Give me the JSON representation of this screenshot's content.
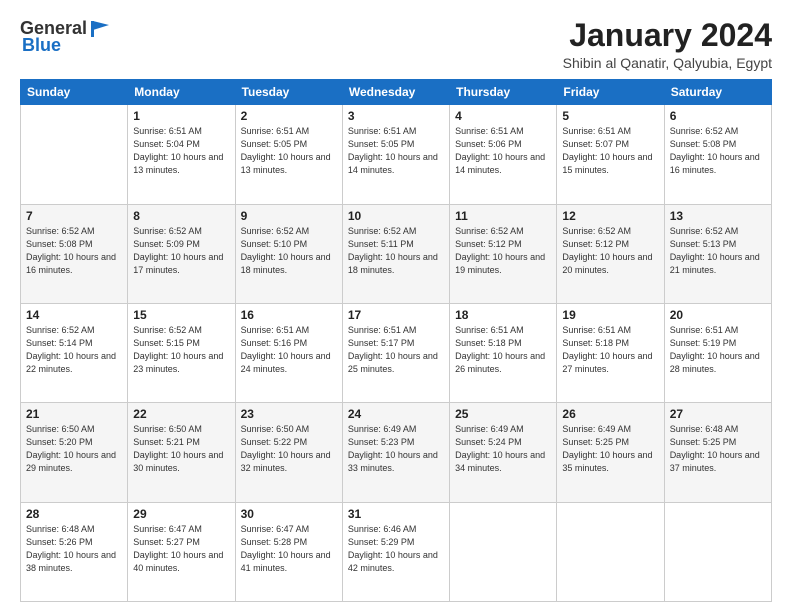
{
  "logo": {
    "general": "General",
    "blue": "Blue"
  },
  "title": {
    "month": "January 2024",
    "location": "Shibin al Qanatir, Qalyubia, Egypt"
  },
  "days_of_week": [
    "Sunday",
    "Monday",
    "Tuesday",
    "Wednesday",
    "Thursday",
    "Friday",
    "Saturday"
  ],
  "weeks": [
    [
      {
        "day": "",
        "sunrise": "",
        "sunset": "",
        "daylight": ""
      },
      {
        "day": "1",
        "sunrise": "Sunrise: 6:51 AM",
        "sunset": "Sunset: 5:04 PM",
        "daylight": "Daylight: 10 hours and 13 minutes."
      },
      {
        "day": "2",
        "sunrise": "Sunrise: 6:51 AM",
        "sunset": "Sunset: 5:05 PM",
        "daylight": "Daylight: 10 hours and 13 minutes."
      },
      {
        "day": "3",
        "sunrise": "Sunrise: 6:51 AM",
        "sunset": "Sunset: 5:05 PM",
        "daylight": "Daylight: 10 hours and 14 minutes."
      },
      {
        "day": "4",
        "sunrise": "Sunrise: 6:51 AM",
        "sunset": "Sunset: 5:06 PM",
        "daylight": "Daylight: 10 hours and 14 minutes."
      },
      {
        "day": "5",
        "sunrise": "Sunrise: 6:51 AM",
        "sunset": "Sunset: 5:07 PM",
        "daylight": "Daylight: 10 hours and 15 minutes."
      },
      {
        "day": "6",
        "sunrise": "Sunrise: 6:52 AM",
        "sunset": "Sunset: 5:08 PM",
        "daylight": "Daylight: 10 hours and 16 minutes."
      }
    ],
    [
      {
        "day": "7",
        "sunrise": "Sunrise: 6:52 AM",
        "sunset": "Sunset: 5:08 PM",
        "daylight": "Daylight: 10 hours and 16 minutes."
      },
      {
        "day": "8",
        "sunrise": "Sunrise: 6:52 AM",
        "sunset": "Sunset: 5:09 PM",
        "daylight": "Daylight: 10 hours and 17 minutes."
      },
      {
        "day": "9",
        "sunrise": "Sunrise: 6:52 AM",
        "sunset": "Sunset: 5:10 PM",
        "daylight": "Daylight: 10 hours and 18 minutes."
      },
      {
        "day": "10",
        "sunrise": "Sunrise: 6:52 AM",
        "sunset": "Sunset: 5:11 PM",
        "daylight": "Daylight: 10 hours and 18 minutes."
      },
      {
        "day": "11",
        "sunrise": "Sunrise: 6:52 AM",
        "sunset": "Sunset: 5:12 PM",
        "daylight": "Daylight: 10 hours and 19 minutes."
      },
      {
        "day": "12",
        "sunrise": "Sunrise: 6:52 AM",
        "sunset": "Sunset: 5:12 PM",
        "daylight": "Daylight: 10 hours and 20 minutes."
      },
      {
        "day": "13",
        "sunrise": "Sunrise: 6:52 AM",
        "sunset": "Sunset: 5:13 PM",
        "daylight": "Daylight: 10 hours and 21 minutes."
      }
    ],
    [
      {
        "day": "14",
        "sunrise": "Sunrise: 6:52 AM",
        "sunset": "Sunset: 5:14 PM",
        "daylight": "Daylight: 10 hours and 22 minutes."
      },
      {
        "day": "15",
        "sunrise": "Sunrise: 6:52 AM",
        "sunset": "Sunset: 5:15 PM",
        "daylight": "Daylight: 10 hours and 23 minutes."
      },
      {
        "day": "16",
        "sunrise": "Sunrise: 6:51 AM",
        "sunset": "Sunset: 5:16 PM",
        "daylight": "Daylight: 10 hours and 24 minutes."
      },
      {
        "day": "17",
        "sunrise": "Sunrise: 6:51 AM",
        "sunset": "Sunset: 5:17 PM",
        "daylight": "Daylight: 10 hours and 25 minutes."
      },
      {
        "day": "18",
        "sunrise": "Sunrise: 6:51 AM",
        "sunset": "Sunset: 5:18 PM",
        "daylight": "Daylight: 10 hours and 26 minutes."
      },
      {
        "day": "19",
        "sunrise": "Sunrise: 6:51 AM",
        "sunset": "Sunset: 5:18 PM",
        "daylight": "Daylight: 10 hours and 27 minutes."
      },
      {
        "day": "20",
        "sunrise": "Sunrise: 6:51 AM",
        "sunset": "Sunset: 5:19 PM",
        "daylight": "Daylight: 10 hours and 28 minutes."
      }
    ],
    [
      {
        "day": "21",
        "sunrise": "Sunrise: 6:50 AM",
        "sunset": "Sunset: 5:20 PM",
        "daylight": "Daylight: 10 hours and 29 minutes."
      },
      {
        "day": "22",
        "sunrise": "Sunrise: 6:50 AM",
        "sunset": "Sunset: 5:21 PM",
        "daylight": "Daylight: 10 hours and 30 minutes."
      },
      {
        "day": "23",
        "sunrise": "Sunrise: 6:50 AM",
        "sunset": "Sunset: 5:22 PM",
        "daylight": "Daylight: 10 hours and 32 minutes."
      },
      {
        "day": "24",
        "sunrise": "Sunrise: 6:49 AM",
        "sunset": "Sunset: 5:23 PM",
        "daylight": "Daylight: 10 hours and 33 minutes."
      },
      {
        "day": "25",
        "sunrise": "Sunrise: 6:49 AM",
        "sunset": "Sunset: 5:24 PM",
        "daylight": "Daylight: 10 hours and 34 minutes."
      },
      {
        "day": "26",
        "sunrise": "Sunrise: 6:49 AM",
        "sunset": "Sunset: 5:25 PM",
        "daylight": "Daylight: 10 hours and 35 minutes."
      },
      {
        "day": "27",
        "sunrise": "Sunrise: 6:48 AM",
        "sunset": "Sunset: 5:25 PM",
        "daylight": "Daylight: 10 hours and 37 minutes."
      }
    ],
    [
      {
        "day": "28",
        "sunrise": "Sunrise: 6:48 AM",
        "sunset": "Sunset: 5:26 PM",
        "daylight": "Daylight: 10 hours and 38 minutes."
      },
      {
        "day": "29",
        "sunrise": "Sunrise: 6:47 AM",
        "sunset": "Sunset: 5:27 PM",
        "daylight": "Daylight: 10 hours and 40 minutes."
      },
      {
        "day": "30",
        "sunrise": "Sunrise: 6:47 AM",
        "sunset": "Sunset: 5:28 PM",
        "daylight": "Daylight: 10 hours and 41 minutes."
      },
      {
        "day": "31",
        "sunrise": "Sunrise: 6:46 AM",
        "sunset": "Sunset: 5:29 PM",
        "daylight": "Daylight: 10 hours and 42 minutes."
      },
      {
        "day": "",
        "sunrise": "",
        "sunset": "",
        "daylight": ""
      },
      {
        "day": "",
        "sunrise": "",
        "sunset": "",
        "daylight": ""
      },
      {
        "day": "",
        "sunrise": "",
        "sunset": "",
        "daylight": ""
      }
    ]
  ]
}
